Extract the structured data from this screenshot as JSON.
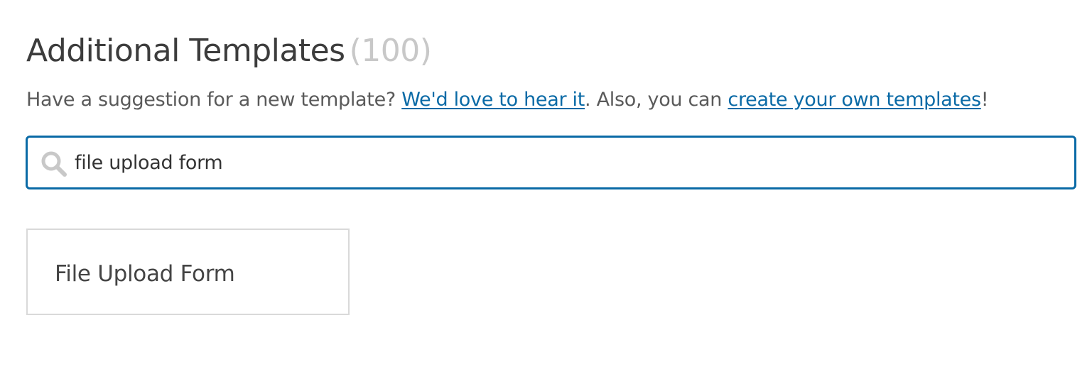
{
  "header": {
    "title": "Additional Templates",
    "count": "(100)"
  },
  "subtitle": {
    "prefix": "Have a suggestion for a new template?",
    "link1": "We'd love to hear it",
    "middle": ". Also, you can",
    "link2": "create your own templates",
    "suffix": "!"
  },
  "search": {
    "icon": "search-icon",
    "value": "file upload form",
    "placeholder": ""
  },
  "results": [
    {
      "title": "File Upload Form"
    }
  ],
  "colors": {
    "accent": "#0a6aa6",
    "count": "#c8c8c8",
    "text": "#3c3c3c"
  }
}
